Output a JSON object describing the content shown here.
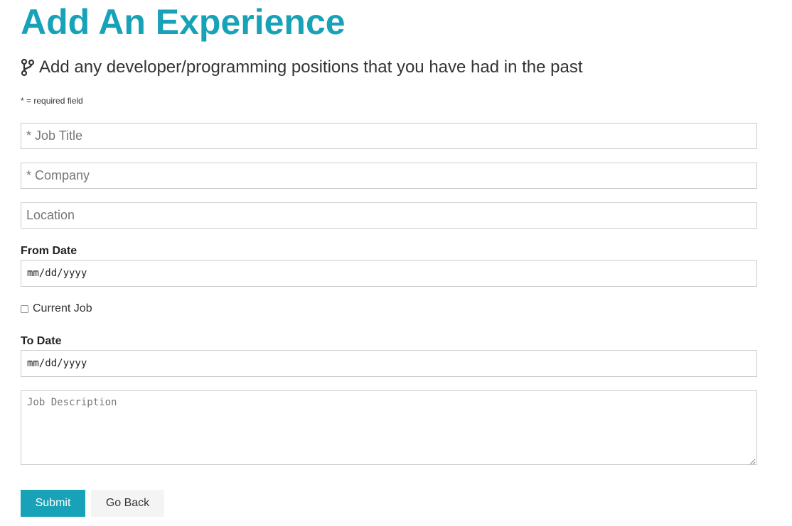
{
  "header": {
    "title": "Add An Experience",
    "lead": "Add any developer/programming positions that you have had in the past",
    "lead_icon": "code-branch-icon",
    "required_note": "* = required field"
  },
  "form": {
    "job_title": {
      "placeholder": "* Job Title",
      "value": ""
    },
    "company": {
      "placeholder": "* Company",
      "value": ""
    },
    "location": {
      "placeholder": "Location",
      "value": ""
    },
    "from_date": {
      "label": "From Date",
      "placeholder": "mm/dd/yyyy"
    },
    "current_job": {
      "label": "Current Job",
      "checked": false
    },
    "to_date": {
      "label": "To Date",
      "placeholder": "mm/dd/yyyy"
    },
    "description": {
      "placeholder": "Job Description",
      "value": ""
    }
  },
  "actions": {
    "submit_label": "Submit",
    "back_label": "Go Back"
  },
  "colors": {
    "accent": "#17a2b8",
    "text": "#333333",
    "border": "#cccccc",
    "secondary_button": "#f4f4f4"
  }
}
